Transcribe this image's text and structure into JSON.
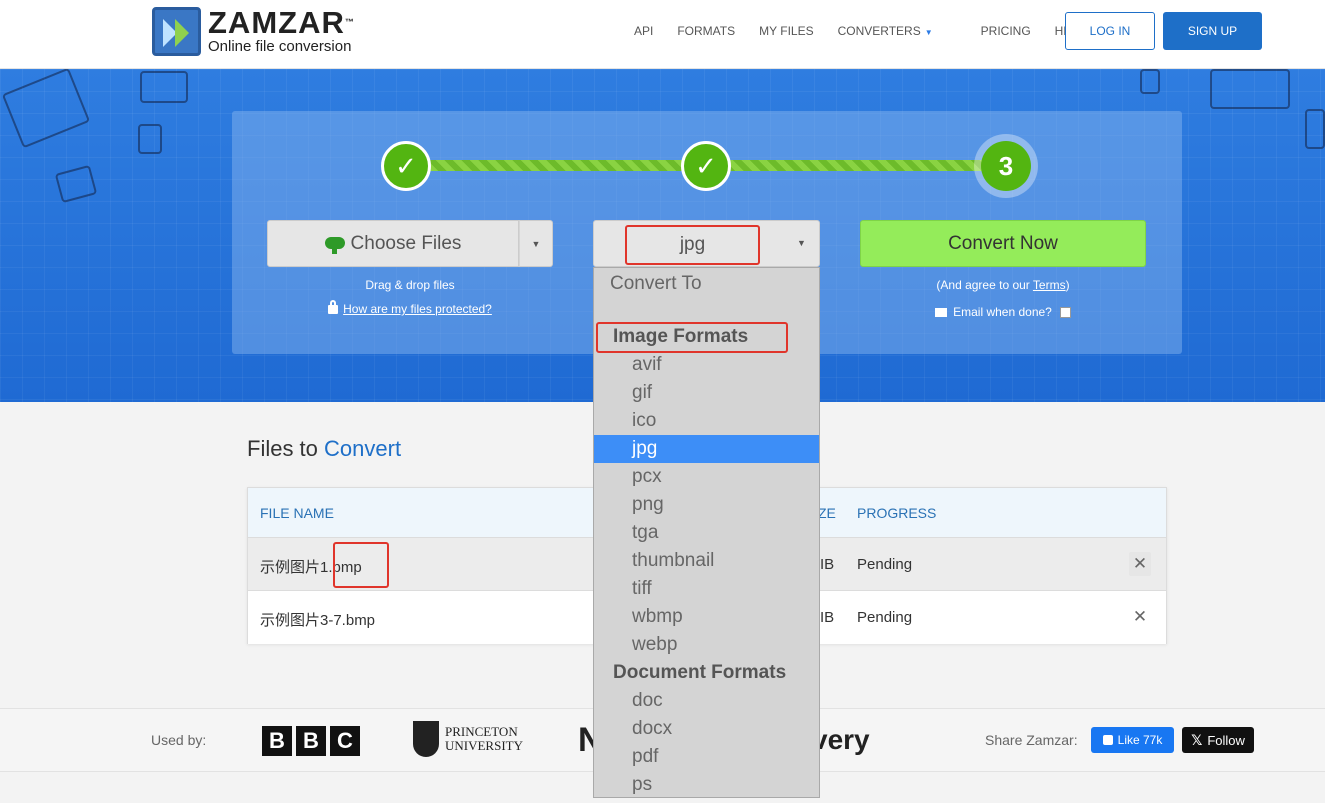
{
  "header": {
    "brand": "ZAMZAR",
    "tm": "™",
    "tagline": "Online file conversion",
    "nav": [
      "API",
      "FORMATS",
      "MY FILES",
      "CONVERTERS",
      "PRICING",
      "HELP"
    ],
    "login_label": "LOG IN",
    "signup_label": "SIGN UP"
  },
  "steps": {
    "step1": "✓",
    "step2": "✓",
    "step3": "3"
  },
  "converter": {
    "choose_label": "Choose Files",
    "dragdrop_text": "Drag & drop files",
    "protected_link": "How are my files protected?",
    "format_value": "jpg",
    "convert_label": "Convert Now",
    "agree_prefix": "(And agree to our ",
    "agree_link": "Terms",
    "agree_suffix": ")",
    "email_label": "Email when done?"
  },
  "dropdown": {
    "placeholder": "Convert To",
    "groups": [
      {
        "header": "Image Formats",
        "options": [
          "avif",
          "gif",
          "ico",
          "jpg",
          "pcx",
          "png",
          "tga",
          "thumbnail",
          "tiff",
          "wbmp",
          "webp"
        ]
      },
      {
        "header": "Document Formats",
        "options": [
          "doc",
          "docx",
          "pdf",
          "ps"
        ]
      }
    ],
    "selected": "jpg"
  },
  "files": {
    "title_part1": "Files to ",
    "title_part2": "Convert",
    "columns": [
      "FILE NAME",
      "ZE",
      "PROGRESS"
    ],
    "rows": [
      {
        "name": "示例图片1.bmp",
        "size": "IB",
        "progress": "Pending"
      },
      {
        "name": "示例图片3-7.bmp",
        "size": "IB",
        "progress": "Pending"
      }
    ],
    "remove_glyph": "✕"
  },
  "footer": {
    "used_by": "Used by:",
    "bbc_letters": [
      "B",
      "B",
      "C"
    ],
    "princeton_line1": "PRINCETON",
    "princeton_line2": "UNIVERSITY",
    "logo_n": "N",
    "logo_discovery": "very",
    "share_label": "Share Zamzar:",
    "fb_like": "Like 77k",
    "x_follow": "Follow",
    "x_glyph": "𝕏"
  },
  "colors": {
    "brand_blue": "#1e6fc8",
    "hero_blue": "#2f7de0",
    "step_green": "#53b511",
    "convert_green": "#94ec5a",
    "highlight_red": "#e0352b",
    "selected_option": "#3d8ef7"
  }
}
